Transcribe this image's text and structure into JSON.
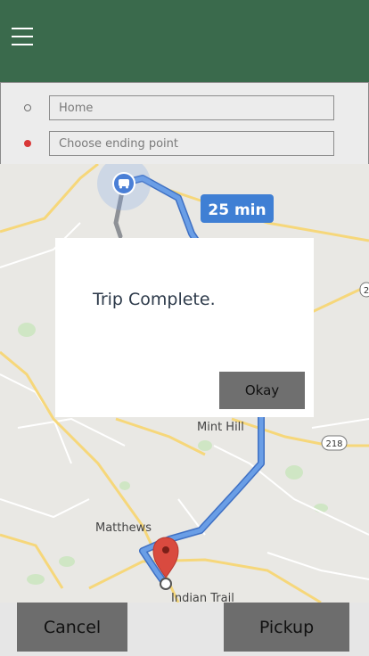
{
  "header": {
    "menu_icon": "hamburger-menu-icon"
  },
  "route_panel": {
    "start_placeholder": "Home",
    "end_placeholder": "Choose ending point",
    "start_marker_color": "#6f6f6f",
    "end_marker_color": "#d93838"
  },
  "map": {
    "eta_badge": "25 min",
    "places": {
      "mint_hill": "Mint Hill",
      "matthews": "Matthews",
      "indian_trail": "Indian Trail",
      "highway_shield": "218",
      "edge_shield": "2"
    },
    "route_color": "#5b8fd8",
    "destination_pin_color": "#d94a3f",
    "vehicle_icon": "car-location-icon"
  },
  "dialog": {
    "message": "Trip Complete.",
    "okay_label": "Okay"
  },
  "footer": {
    "cancel_label": "Cancel",
    "pickup_label": "Pickup"
  }
}
